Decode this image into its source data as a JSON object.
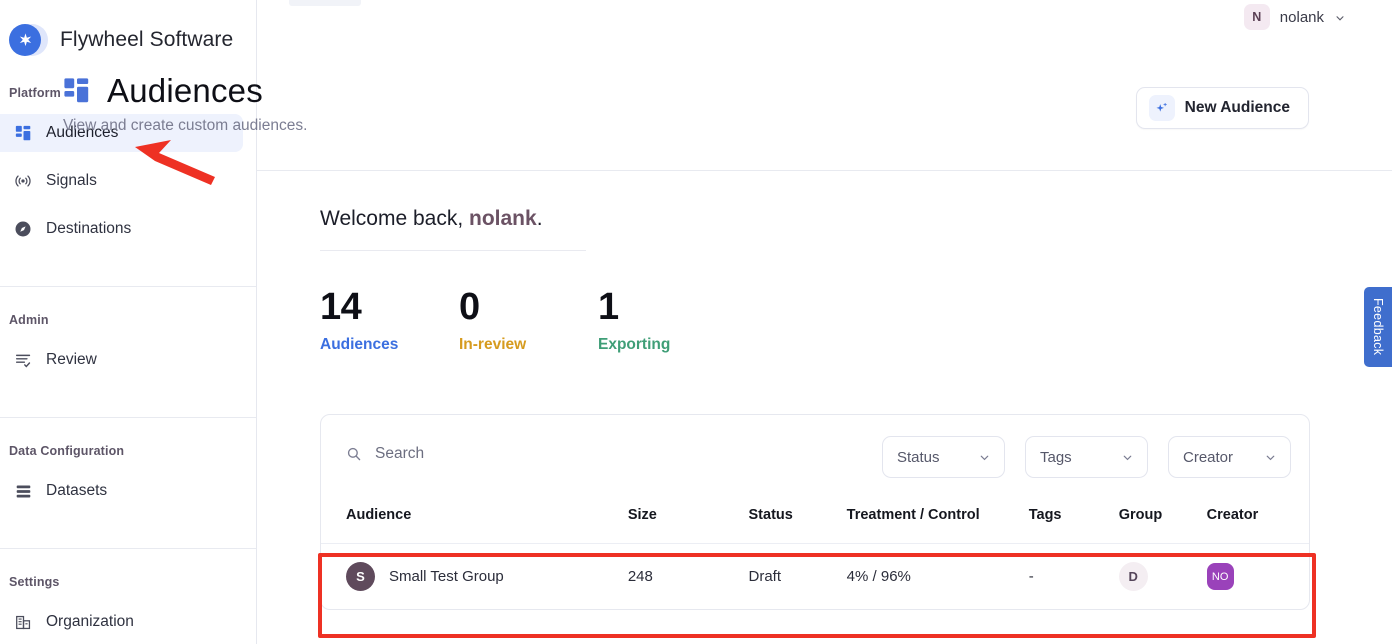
{
  "brand": {
    "name": "Flywheel Software",
    "logo_icon": "star-burst-icon"
  },
  "sidebar": {
    "sections": [
      {
        "label": "Platform",
        "items": [
          {
            "label": "Audiences",
            "icon": "grid-blocks-icon",
            "active": true
          },
          {
            "label": "Signals",
            "icon": "broadcast-icon",
            "active": false
          },
          {
            "label": "Destinations",
            "icon": "compass-icon",
            "active": false
          }
        ]
      },
      {
        "label": "Admin",
        "items": [
          {
            "label": "Review",
            "icon": "list-check-icon",
            "active": false
          }
        ]
      },
      {
        "label": "Data Configuration",
        "items": [
          {
            "label": "Datasets",
            "icon": "database-rows-icon",
            "active": false
          }
        ]
      },
      {
        "label": "Settings",
        "items": [
          {
            "label": "Organization",
            "icon": "building-icon",
            "active": false
          }
        ]
      }
    ]
  },
  "userbar": {
    "avatar_initial": "N",
    "name": "nolank",
    "caret_icon": "chevron-down-icon"
  },
  "header": {
    "title": "Audiences",
    "title_icon": "grid-blocks-icon",
    "subtitle": "View and create custom audiences.",
    "new_audience_label": "New Audience",
    "new_audience_icon": "sparkle-plus-icon"
  },
  "welcome": {
    "greeting": "Welcome back,",
    "user": "nolank",
    "period": "."
  },
  "stats": [
    {
      "value": "14",
      "label": "Audiences",
      "color": "#3b6fe0"
    },
    {
      "value": "0",
      "label": "In-review",
      "color": "#d69b1e"
    },
    {
      "value": "1",
      "label": "Exporting",
      "color": "#3f9e77"
    }
  ],
  "toolbar": {
    "search_placeholder": "Search",
    "search_value": "",
    "search_icon": "search-icon",
    "filters": [
      {
        "label": "Status",
        "icon": "chevron-down-icon"
      },
      {
        "label": "Tags",
        "icon": "chevron-down-icon"
      },
      {
        "label": "Creator",
        "icon": "chevron-down-icon"
      }
    ]
  },
  "table": {
    "columns": [
      "Audience",
      "Size",
      "Status",
      "Treatment / Control",
      "Tags",
      "Group",
      "Creator"
    ],
    "rows": [
      {
        "avatar_initial": "S",
        "audience": "Small Test Group",
        "size": "248",
        "status": "Draft",
        "treatment_control": "4% / 96%",
        "tags": "-",
        "group": "D",
        "creator": "NO"
      }
    ]
  },
  "feedback": {
    "label": "Feedback"
  },
  "annotations": {
    "arrow": {
      "target": "sidebar-item-audiences",
      "color": "#ee3124"
    },
    "rect": {
      "target": "table-row",
      "color": "#ee3124"
    }
  }
}
